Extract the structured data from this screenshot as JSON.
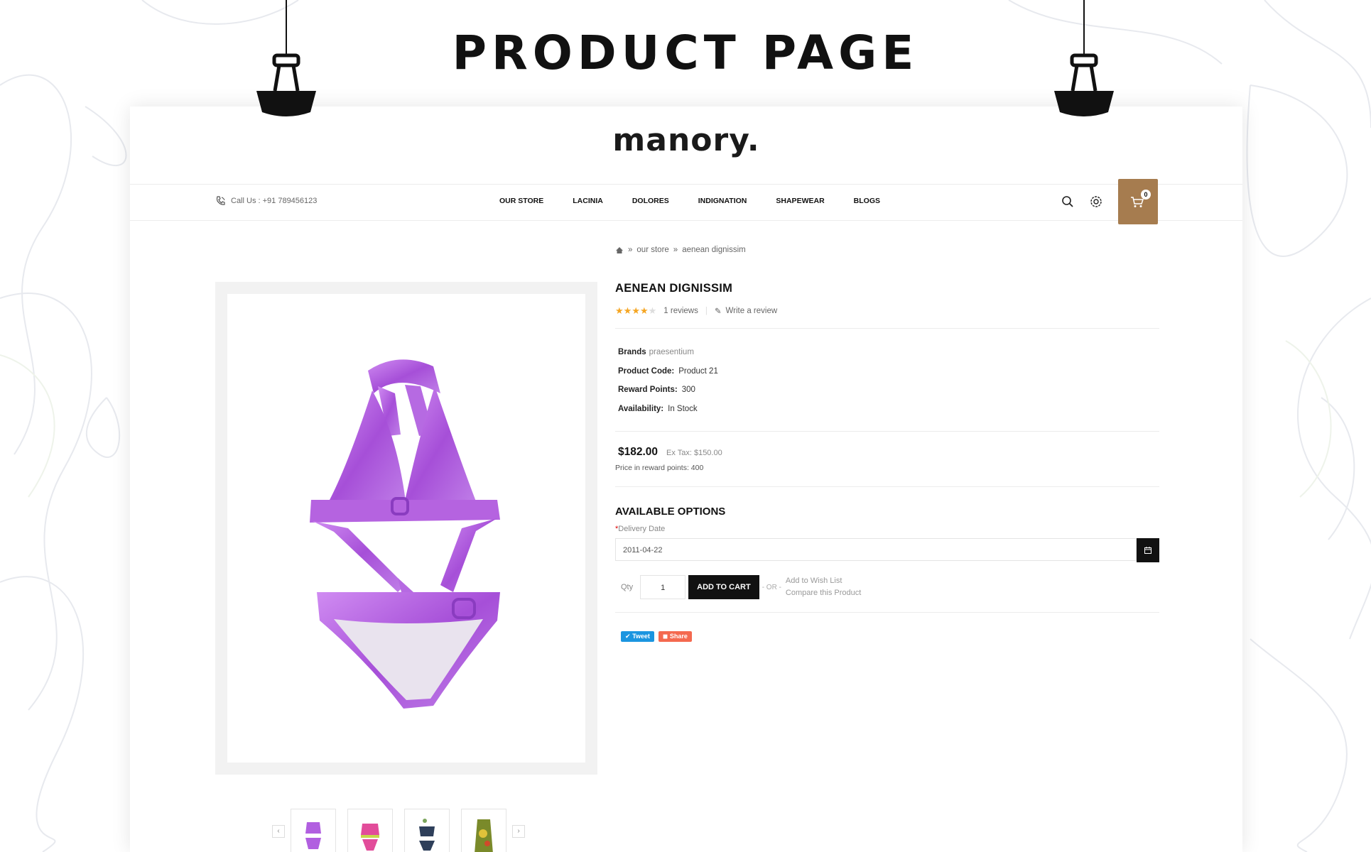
{
  "banner": {
    "title": "PRODUCT PAGE"
  },
  "store": {
    "logo": "manory.",
    "call": "Call Us : +91 789456123",
    "nav": [
      "OUR STORE",
      "LACINIA",
      "DOLORES",
      "INDIGNATION",
      "SHAPEWEAR",
      "BLOGS"
    ],
    "cart_count": "0",
    "icons": {
      "search": "search-icon",
      "settings": "gear-icon",
      "cart": "cart-icon",
      "phone": "phone-icon",
      "home": "home-icon"
    }
  },
  "breadcrumb": {
    "items": [
      "our store",
      "aenean dignissim"
    ]
  },
  "product": {
    "title": "AENEAN DIGNISSIM",
    "rating": 4,
    "reviews": "1 reviews",
    "write_review": "Write a review",
    "brand_label": "Brands",
    "brand_value": "praesentium",
    "code_label": "Product Code:",
    "code_value": "Product 21",
    "reward_label": "Reward Points:",
    "reward_value": "300",
    "availability_label": "Availability:",
    "availability_value": "In Stock",
    "price": "$182.00",
    "ex_tax": "Ex Tax: $150.00",
    "price_reward": "Price in reward points: 400"
  },
  "options": {
    "title": "AVAILABLE OPTIONS",
    "delivery_label": "Delivery Date",
    "delivery_value": "2011-04-22",
    "qty_label": "Qty",
    "qty_value": "1",
    "add_to_cart": "ADD TO CART",
    "or": "- OR -",
    "wishlist": "Add to Wish List",
    "compare": "Compare this Product"
  },
  "share": {
    "tweet": "Tweet",
    "share": "Share"
  },
  "colors": {
    "accent_cart": "#a67c4f",
    "product": "#b15fe0",
    "star": "#f5a623"
  }
}
